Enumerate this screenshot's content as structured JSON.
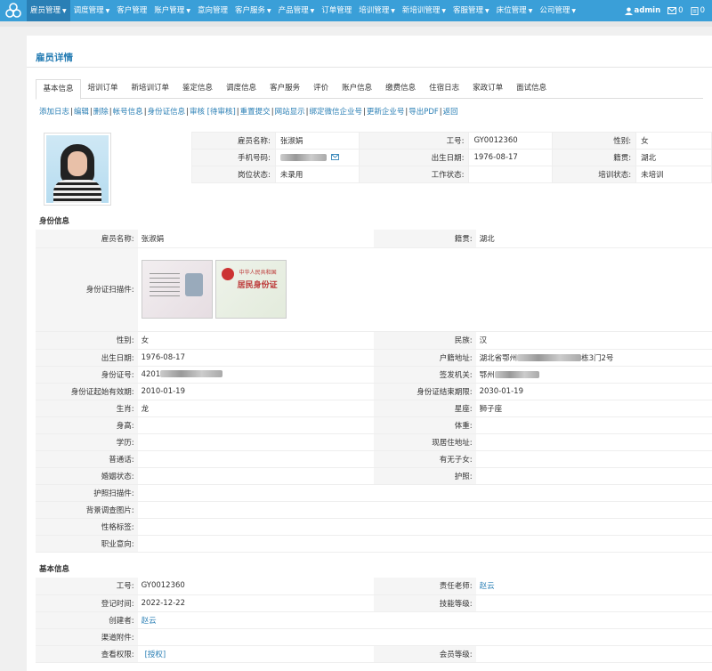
{
  "nav": {
    "items": [
      {
        "label": "雇员管理",
        "dropdown": true,
        "active": true
      },
      {
        "label": "调度管理",
        "dropdown": true
      },
      {
        "label": "客户管理",
        "dropdown": false
      },
      {
        "label": "账户管理",
        "dropdown": true
      },
      {
        "label": "意向管理",
        "dropdown": false
      },
      {
        "label": "客户服务",
        "dropdown": true
      },
      {
        "label": "产品管理",
        "dropdown": true
      },
      {
        "label": "订单管理",
        "dropdown": false
      },
      {
        "label": "培训管理",
        "dropdown": true
      },
      {
        "label": "新培训管理",
        "dropdown": true
      },
      {
        "label": "客服管理",
        "dropdown": true
      },
      {
        "label": "床位管理",
        "dropdown": true
      },
      {
        "label": "公司管理",
        "dropdown": true
      }
    ],
    "user": "admin",
    "messages": "0",
    "notifications": "0"
  },
  "page_title": "雇员详情",
  "tabs": [
    "基本信息",
    "培训订单",
    "新培训订单",
    "鉴定信息",
    "调度信息",
    "客户服务",
    "评价",
    "账户信息",
    "缴费信息",
    "住宿日志",
    "家政订单",
    "面试信息"
  ],
  "actions": [
    "添加日志",
    "编辑",
    "删除",
    "帐号信息",
    "身份证信息",
    "审核 [待审核]",
    "重置提交",
    "网站显示",
    "绑定微信企业号",
    "更新企业号",
    "导出PDF",
    "返回"
  ],
  "summary": {
    "name_label": "雇员名称:",
    "name": "张淑娟",
    "job_no_label": "工号:",
    "job_no": "GY0012360",
    "gender_label": "性别:",
    "gender": "女",
    "phone_label": "手机号码:",
    "birth_label": "出生日期:",
    "birth": "1976-08-17",
    "origin_label": "籍贯:",
    "origin": "湖北",
    "post_label": "岗位状态:",
    "post": "未录用",
    "work_label": "工作状态:",
    "work": "",
    "training_label": "培训状态:",
    "training": "未培训"
  },
  "identity": {
    "section": "身份信息",
    "name_label": "雇员名称:",
    "name": "张淑娟",
    "origin_label": "籍贯:",
    "origin": "湖北",
    "scan_label": "身份证扫描件:",
    "card_country": "中华人民共和国",
    "card_title": "居民身份证",
    "gender_label": "性别:",
    "gender": "女",
    "ethnic_label": "民族:",
    "ethnic": "汉",
    "birth_label": "出生日期:",
    "birth": "1976-08-17",
    "address_label": "户籍地址:",
    "address_start": "湖北省鄂州",
    "address_end": "栋3门2号",
    "id_label": "身份证号:",
    "id_start": "4201",
    "issuer_label": "签发机关:",
    "issuer_start": "鄂州",
    "valid_from_label": "身份证起始有效期:",
    "valid_from": "2010-01-19",
    "valid_to_label": "身份证结束期限:",
    "valid_to": "2030-01-19",
    "zodiac_label": "生肖:",
    "zodiac": "龙",
    "star_label": "星座:",
    "star": "狮子座",
    "height_label": "身高:",
    "weight_label": "体重:",
    "edu_label": "学历:",
    "residence_label": "现居住地址:",
    "mandarin_label": "普通话:",
    "children_label": "有无子女:",
    "marital_label": "婚姻状态:",
    "passport_label": "护照:",
    "passport_scan_label": "护照扫描件:",
    "background_label": "背景调查图片:",
    "tags_label": "性格标签:",
    "intent_label": "职业意向:"
  },
  "basic": {
    "section": "基本信息",
    "job_no_label": "工号:",
    "job_no": "GY0012360",
    "teacher_label": "责任老师:",
    "teacher": "赵云",
    "reg_label": "登记时间:",
    "reg": "2022-12-22",
    "skill_label": "技能等级:",
    "creator_label": "创建者:",
    "creator": "赵云",
    "channel_label": "渠道附件:",
    "perm_label": "查看权限:",
    "perm": "[授权]",
    "member_label": "会员等级:"
  },
  "colors": {
    "nav": "#3a9fd8",
    "accent": "#2a7fb5"
  }
}
